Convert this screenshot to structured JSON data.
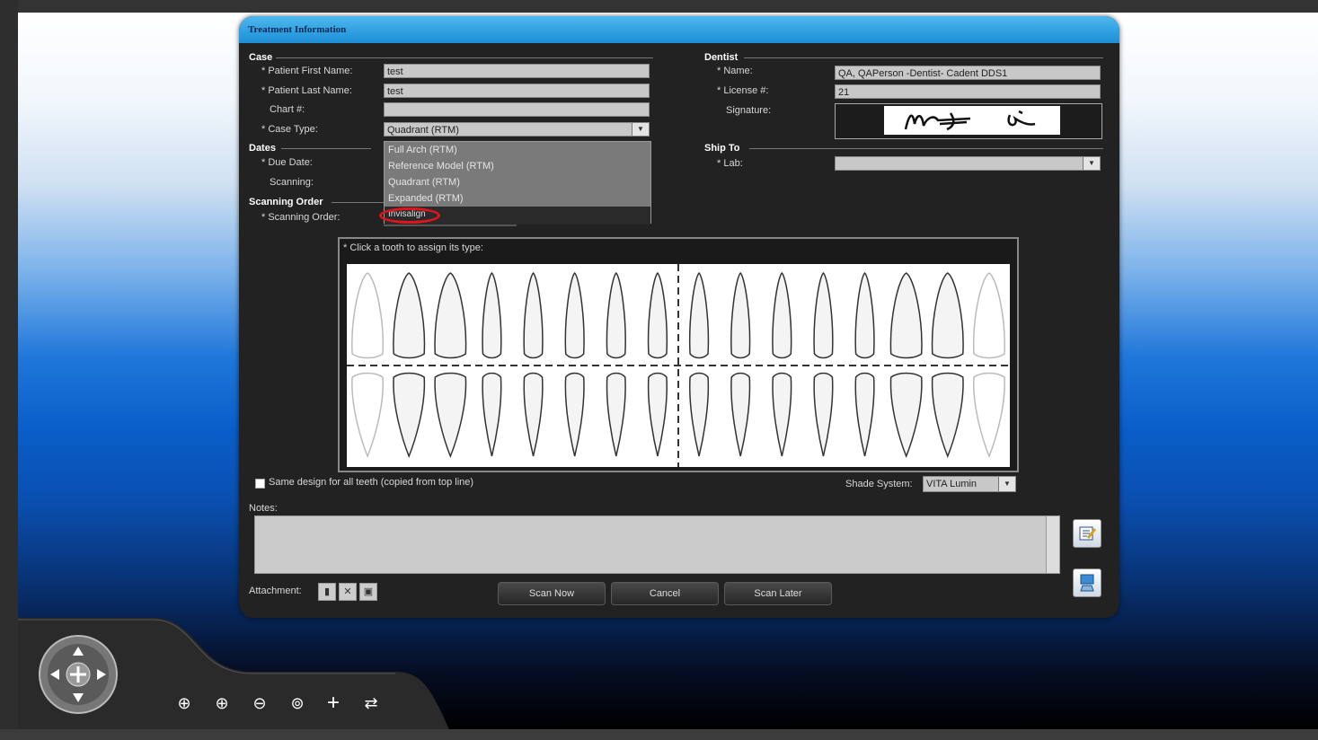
{
  "dialog": {
    "title": "Treatment Information"
  },
  "case": {
    "section_label": "Case",
    "first_name_label": "* Patient First Name:",
    "first_name_value": "test",
    "last_name_label": "* Patient Last Name:",
    "last_name_value": "test",
    "chart_label": "Chart #:",
    "chart_value": "",
    "case_type_label": "* Case Type:",
    "case_type_value": "Quadrant (RTM)",
    "case_type_options": [
      "Full Arch (RTM)",
      "Reference Model (RTM)",
      "Quadrant (RTM)",
      "Expanded (RTM)",
      "Invisalign"
    ]
  },
  "dates": {
    "section_label": "Dates",
    "due_date_label": "* Due Date:",
    "scanning_label": "Scanning:"
  },
  "scanning_order": {
    "section_label": "Scanning Order",
    "label": "* Scanning Order:"
  },
  "dentist": {
    "section_label": "Dentist",
    "name_label": "* Name:",
    "name_value": "QA, QAPerson -Dentist- Cadent DDS1",
    "license_label": "* License #:",
    "license_value": "21",
    "signature_label": "Signature:"
  },
  "ship_to": {
    "section_label": "Ship To",
    "lab_label": "* Lab:",
    "lab_value": ""
  },
  "teeth": {
    "instruction": "* Click a tooth to assign its type:"
  },
  "options": {
    "same_design_label": "Same design for all teeth (copied from top line)",
    "shade_system_label": "Shade System:",
    "shade_system_value": "VITA Lumin"
  },
  "notes": {
    "label": "Notes:",
    "value": ""
  },
  "attachment": {
    "label": "Attachment:"
  },
  "buttons": {
    "scan_now": "Scan Now",
    "cancel": "Cancel",
    "scan_later": "Scan Later"
  },
  "colors": {
    "title_bar": "#1b8fd6",
    "dialog_bg": "#222222",
    "highlight": "#e0141a"
  },
  "icons": {
    "nav": "navigation-joystick-icon",
    "tools": [
      "zoom-in-icon",
      "zoom-in-alt-icon",
      "zoom-out-icon",
      "zoom-fit-icon",
      "pan-icon",
      "rotate-icon"
    ]
  }
}
